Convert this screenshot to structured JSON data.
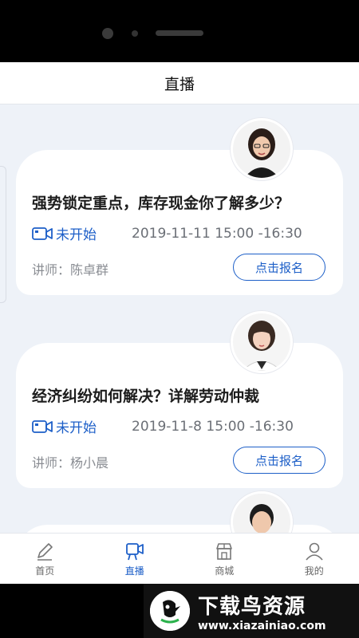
{
  "header": {
    "title": "直播"
  },
  "courses": [
    {
      "title": "强势锁定重点，库存现金你了解多少？",
      "status": "未开始",
      "time": "2019-11-11 15:00 -16:30",
      "lecturer": "讲师：陈卓群",
      "button": "点击报名"
    },
    {
      "title": "经济纠纷如何解决？详解劳动仲裁",
      "status": "未开始",
      "time": "2019-11-8 15:00 -16:30",
      "lecturer": "讲师：杨小晨",
      "button": "点击报名"
    }
  ],
  "tabs": [
    {
      "label": "首页",
      "icon": "pen-icon"
    },
    {
      "label": "直播",
      "icon": "live-camera-icon",
      "active": true
    },
    {
      "label": "商城",
      "icon": "shop-icon"
    },
    {
      "label": "我的",
      "icon": "user-icon"
    }
  ],
  "watermark": {
    "title": "下载鸟资源",
    "url": "www.xiazainiao.com"
  },
  "colors": {
    "accent": "#1d5fc8",
    "background": "#eef2f8"
  }
}
